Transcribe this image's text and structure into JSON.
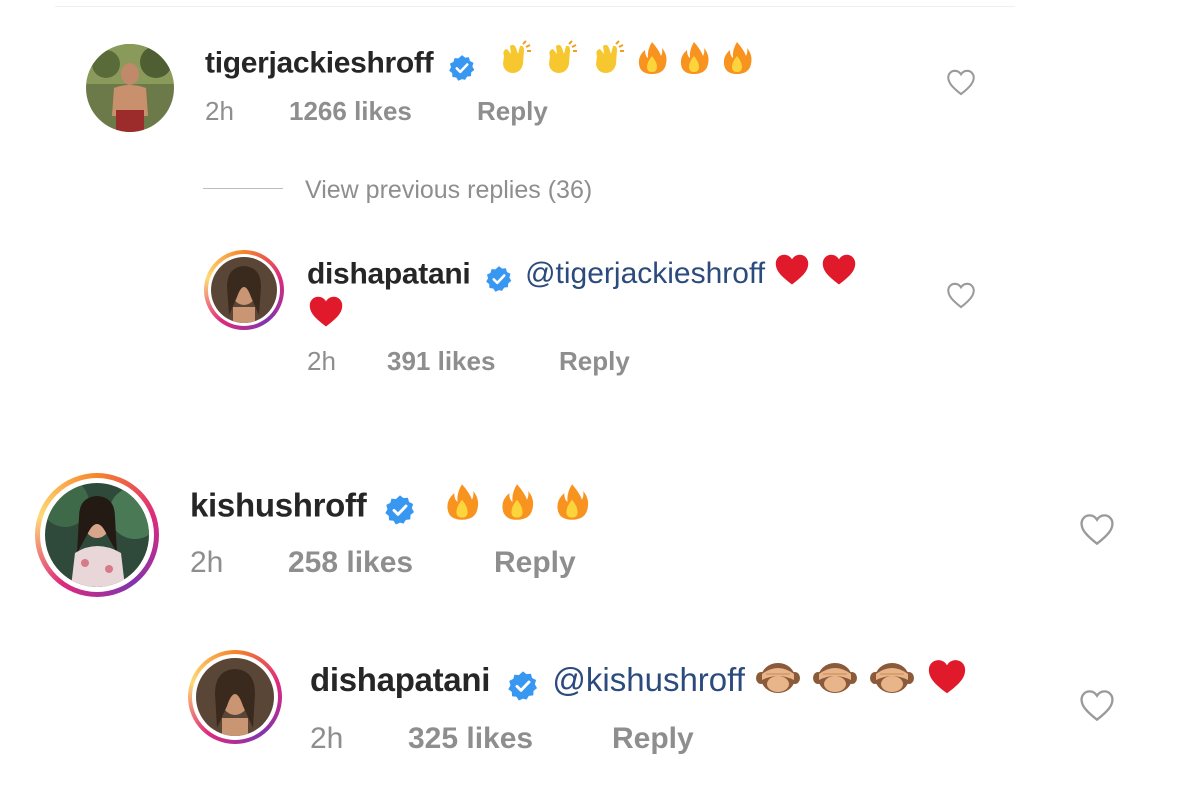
{
  "view_previous_replies": "View previous replies (36)",
  "comments": [
    {
      "username": "tigerjackieshroff",
      "mention": "",
      "time": "2h",
      "likes": "1266 likes",
      "reply": "Reply"
    },
    {
      "username": "dishapatani",
      "mention": "@tigerjackieshroff",
      "time": "2h",
      "likes": "391 likes",
      "reply": "Reply"
    },
    {
      "username": "kishushroff",
      "mention": "",
      "time": "2h",
      "likes": "258 likes",
      "reply": "Reply"
    },
    {
      "username": "dishapatani",
      "mention": "@kishushroff",
      "time": "2h",
      "likes": "325 likes",
      "reply": "Reply"
    }
  ],
  "icons": {
    "verified": "verified-badge-icon",
    "like": "heart-outline-icon",
    "clap": "clapping-hands-emoji",
    "fire": "fire-emoji",
    "heart": "red-heart-emoji",
    "monkey": "see-no-evil-monkey-emoji"
  },
  "colors": {
    "verified_blue": "#3897f0",
    "meta_gray": "#8e8e8e",
    "mention_blue": "#2b4a7d",
    "heart_red": "#e0192b",
    "fire_orange": "#f7931e",
    "clap_yellow": "#f7c72f"
  }
}
